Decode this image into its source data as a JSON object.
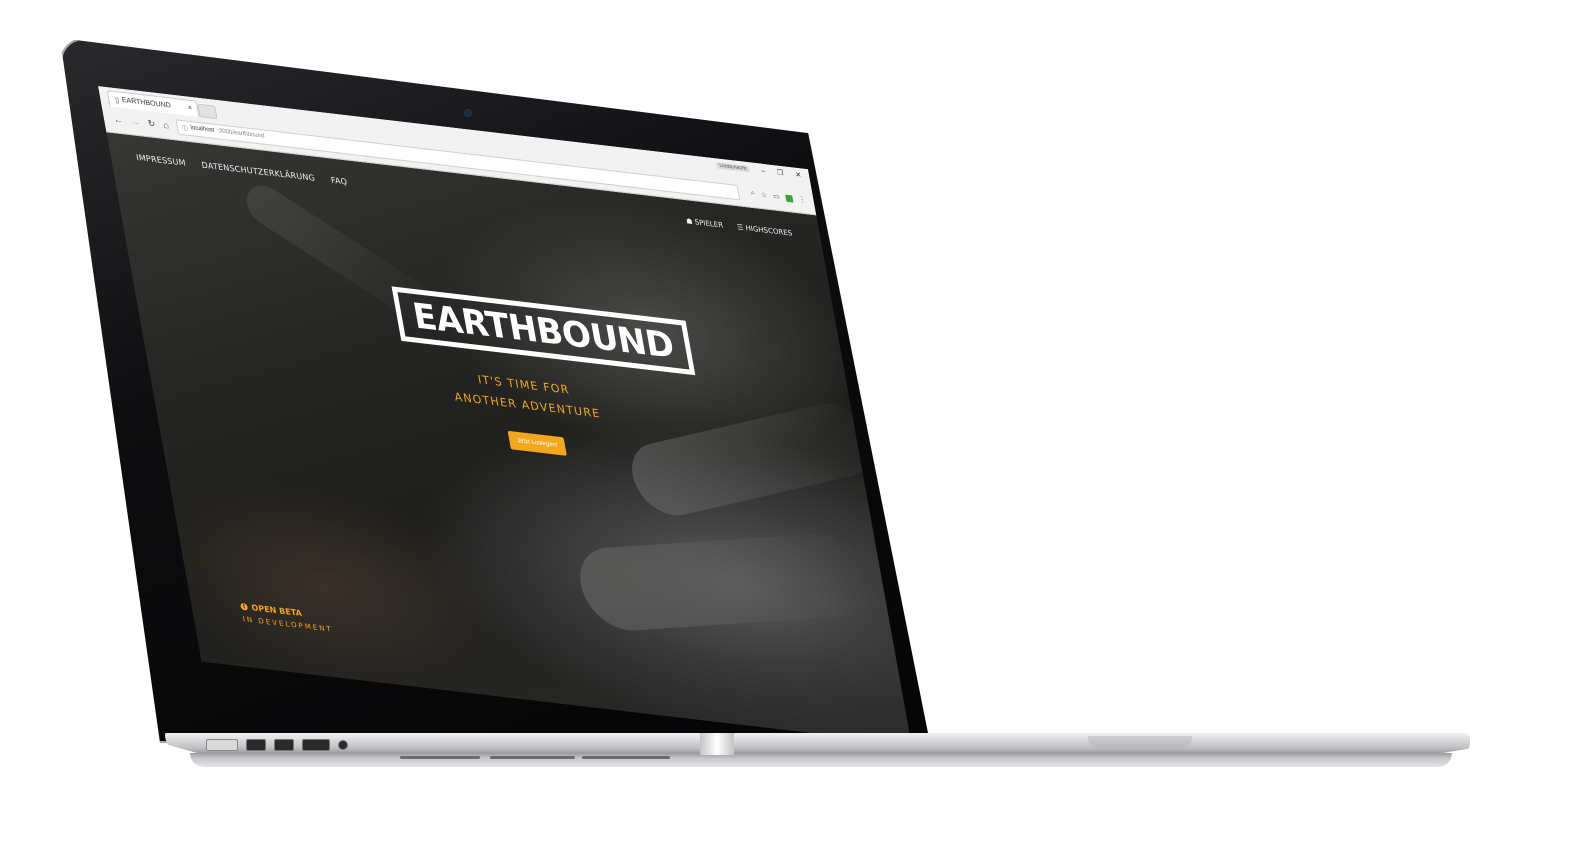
{
  "browser": {
    "tab_title": "EARTHBOUND",
    "tab_close": "×",
    "url_host": "localhost",
    "url_path": ":3000/earthbound",
    "profile_label": "Lindschacht",
    "window_controls": [
      "–",
      "❐",
      "✕"
    ]
  },
  "site": {
    "nav_left": [
      "IMPRESSUM",
      "DATENSCHUTZERKLÄRUNG",
      "FAQ"
    ],
    "nav_right": [
      {
        "icon": "users-icon",
        "label": "SPIELER"
      },
      {
        "icon": "list-icon",
        "label": "HIGHSCORES"
      }
    ],
    "logo_text": "EARTHBOUND",
    "tagline_line1": "IT'S TIME FOR",
    "tagline_line2": "ANOTHER ADVENTURE",
    "cta_label": "Jetzt Loslegen!",
    "beta_title": "OPEN BETA",
    "beta_subtitle": "IN DEVELOPMENT"
  },
  "colors": {
    "accent": "#f2a71e",
    "hero_dark": "#1a1a1a",
    "laptop_silver": "#d8d8da"
  }
}
